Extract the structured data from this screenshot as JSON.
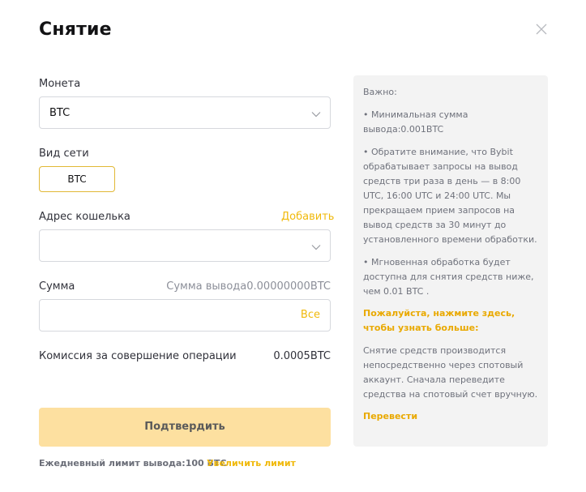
{
  "modal": {
    "title": "Снятие",
    "close_icon": "close-icon"
  },
  "coin": {
    "label": "Монета",
    "selected": "BTC"
  },
  "network": {
    "label": "Вид сети",
    "option": "BTC"
  },
  "wallet": {
    "label": "Адрес кошелька",
    "add_link": "Добавить",
    "value": ""
  },
  "amount": {
    "label": "Сумма",
    "available": "Сумма вывода0.00000000BTC",
    "value": "",
    "all_label": "Все"
  },
  "fee": {
    "label": "Комиссия за совершение операции",
    "value": "0.0005BTC"
  },
  "confirm_button": "Подтвердить",
  "limit": {
    "text": "Ежедневный лимит вывода:100 BTC",
    "link": "Увеличить лимит"
  },
  "info": {
    "important": "Важно:",
    "bullet1": "• Минимальная сумма вывода:0.001BTC",
    "bullet2": "• Обратите внимание, что Bybit обрабатывает запросы на вывод средств три раза в день — в 8:00 UTC, 16:00 UTC и 24:00 UTC. Мы прекращаем прием запросов на вывод средств за 30 минут до установленного времени обработки.",
    "bullet3": "• Мгновенная обработка будет доступна для снятия средств ниже, чем 0.01 BTC .",
    "more_link": "Пожалуйста, нажмите здесь, чтобы узнать больше:",
    "note": "Снятие средств производится непосредственно через спотовый аккаунт. Сначала переведите средства на спотовый счет вручную.",
    "transfer_link": "Перевести"
  },
  "colors": {
    "accent": "#f0b90b",
    "confirm_bg": "#fde0a0",
    "panel_bg": "#f3f3f3"
  }
}
